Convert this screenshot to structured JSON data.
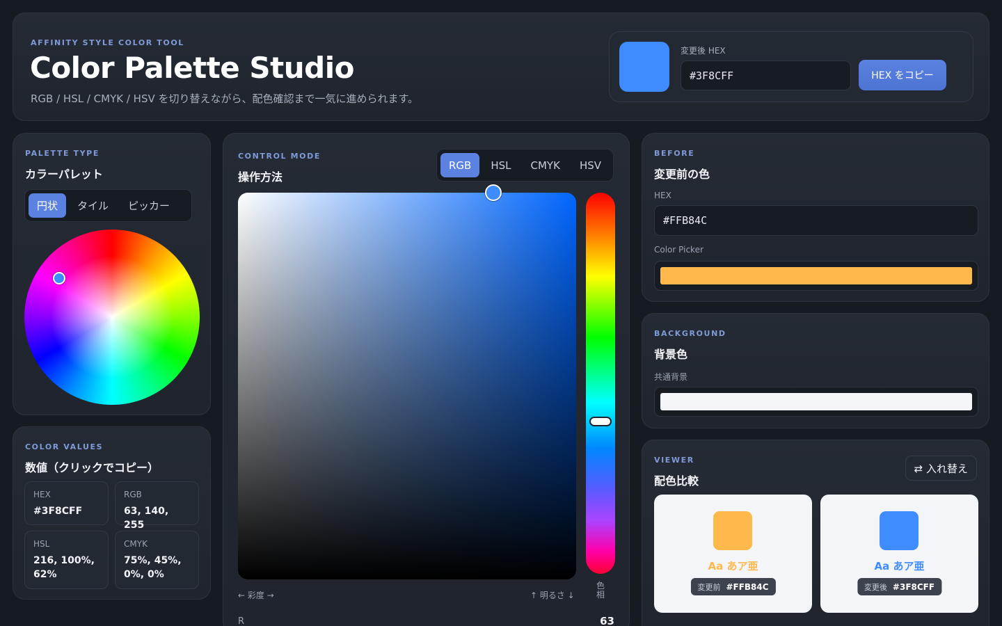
{
  "header": {
    "eyebrow": "AFFINITY STYLE COLOR TOOL",
    "title": "Color Palette Studio",
    "description": "RGB / HSL / CMYK / HSV を切り替えながら、配色確認まで一気に進められます。",
    "hex_label": "変更後 HEX",
    "hex_value": "#3F8CFF",
    "copy_button": "HEX をコピー",
    "swatch_color": "#3F8CFF"
  },
  "palette": {
    "eyebrow": "PALETTE TYPE",
    "title": "カラーパレット",
    "tabs": [
      "円状",
      "タイル",
      "ピッカー"
    ],
    "active_tab": "円状"
  },
  "values": {
    "eyebrow": "COLOR VALUES",
    "title": "数値（クリックでコピー）",
    "items": [
      {
        "label": "HEX",
        "value": "#3F8CFF"
      },
      {
        "label": "RGB",
        "value": "63, 140, 255"
      },
      {
        "label": "HSL",
        "value": "216, 100%, 62%"
      },
      {
        "label": "CMYK",
        "value": "75%, 45%, 0%, 0%"
      }
    ]
  },
  "control": {
    "eyebrow": "CONTROL MODE",
    "title": "操作方法",
    "modes": [
      "RGB",
      "HSL",
      "CMYK",
      "HSV"
    ],
    "active_mode": "RGB",
    "saturation_label": "← 彩度 →",
    "brightness_label": "↑ 明るさ ↓",
    "hue_label": "色相",
    "channel_label": "R",
    "channel_value": "63"
  },
  "before": {
    "eyebrow": "BEFORE",
    "title": "変更前の色",
    "hex_label": "HEX",
    "hex_value": "#FFB84C",
    "picker_label": "Color Picker",
    "color": "#FFB84C"
  },
  "background": {
    "eyebrow": "BACKGROUND",
    "title": "背景色",
    "common_label": "共通背景",
    "color": "#F3F5F8"
  },
  "viewer": {
    "eyebrow": "VIEWER",
    "title": "配色比較",
    "swap_button": "⇄ 入れ替え",
    "before": {
      "sample": "Aa あア亜",
      "tag": "変更前",
      "hex": "#FFB84C",
      "color": "#FFB84C"
    },
    "after": {
      "sample": "Aa あア亜",
      "tag": "変更後",
      "hex": "#3F8CFF",
      "color": "#3F8CFF"
    }
  },
  "colors": {
    "accent": "#5B82E0",
    "background": "#161A21",
    "card": "#222832"
  }
}
